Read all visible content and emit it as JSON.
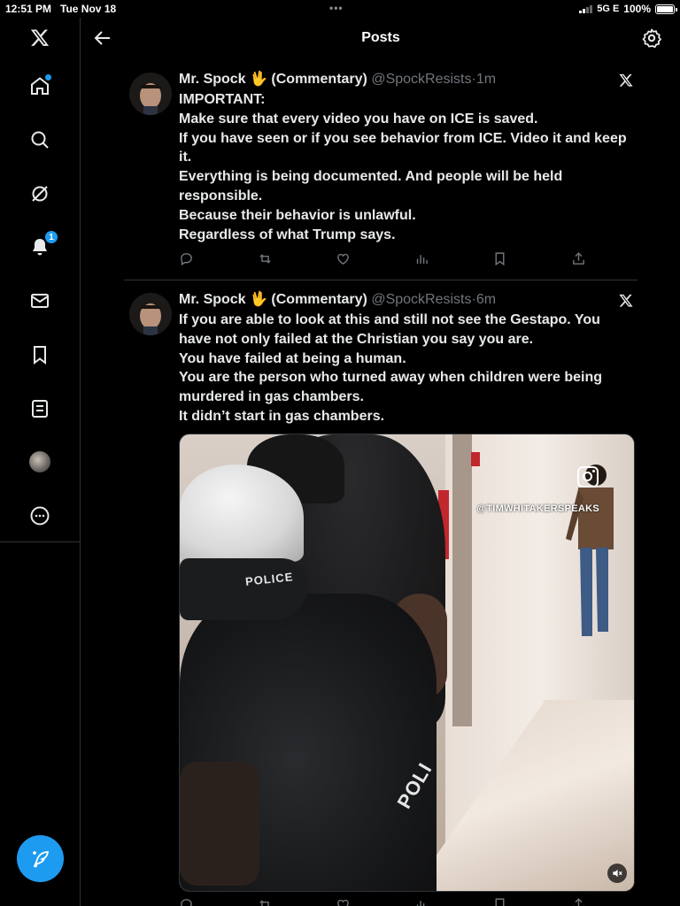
{
  "status_bar": {
    "time": "12:51 PM",
    "date": "Tue Nov 18",
    "network": "5G E",
    "battery": "100%"
  },
  "sidebar": {
    "items": [
      {
        "name": "x-logo-icon"
      },
      {
        "name": "home-icon",
        "has_dot": true
      },
      {
        "name": "search-icon"
      },
      {
        "name": "grok-icon"
      },
      {
        "name": "notifications-icon",
        "badge": "1"
      },
      {
        "name": "messages-icon"
      },
      {
        "name": "bookmarks-icon"
      },
      {
        "name": "lists-icon"
      },
      {
        "name": "profile-avatar"
      },
      {
        "name": "more-icon"
      }
    ],
    "compose_icon": "compose-icon"
  },
  "header": {
    "title": "Posts"
  },
  "posts": [
    {
      "author": "Mr. Spock",
      "emoji": "🖖",
      "suffix": "(Commentary)",
      "handle": "@SpockResists",
      "sep": "·",
      "time": "1m",
      "lines": [
        "IMPORTANT:",
        "Make sure that every video you have on ICE is saved.",
        "If you have seen or if you see behavior from ICE. Video it and keep it.",
        "Everything is being documented. And people will be held responsible.",
        "Because their behavior is unlawful.",
        "Regardless of what Trump says."
      ]
    },
    {
      "author": "Mr. Spock",
      "emoji": "🖖",
      "suffix": "(Commentary)",
      "handle": "@SpockResists",
      "sep": "·",
      "time": "6m",
      "lines": [
        "If you are able to look at this and still not see the Gestapo. You have not only failed at the Christian you say you are.",
        "You have failed at being a human.",
        "You are the person who turned away when children were being murdered in gas chambers.",
        "It didn’t start in gas chambers."
      ],
      "video": {
        "watermark": "@TIMWHITAKERSPEAKS",
        "vest_text_1": "POLICE",
        "vest_text_2": "POLI"
      }
    }
  ],
  "colors": {
    "accent": "#1d9bf0",
    "background": "#000000",
    "text": "#e7e9ea",
    "muted": "#71767b",
    "divider": "#2f3336"
  }
}
